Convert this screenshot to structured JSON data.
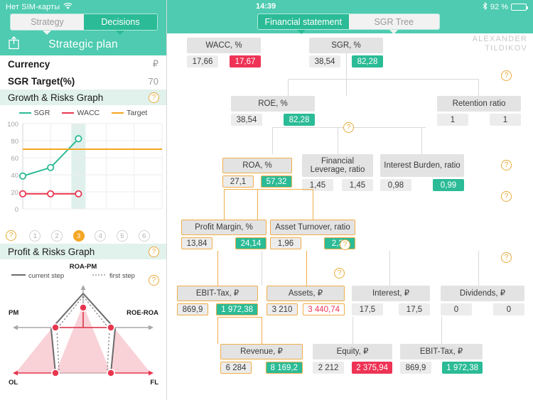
{
  "left": {
    "status": {
      "carrier": "Нет SIM-карты",
      "wifi_icon": "wifi-icon"
    },
    "segmented": {
      "inactive_label": "Strategy",
      "active_label": "Decisions"
    },
    "header": {
      "title": "Strategic plan",
      "share_icon": "share-icon"
    },
    "rows": [
      {
        "label": "Currency",
        "value": "₽"
      },
      {
        "label": "SGR Target(%)",
        "value": "70"
      }
    ],
    "growth_section": {
      "title": "Growth & Risks Graph",
      "help": "?"
    },
    "steps": {
      "items": [
        "1",
        "2",
        "3",
        "4",
        "5",
        "6"
      ],
      "selected": "3",
      "help": "?"
    },
    "profit_section": {
      "title": "Profit & Risks Graph",
      "help": "?"
    },
    "profit_graph": {
      "legend_current": "current step",
      "legend_first": "first step",
      "axis_top": "ROA-PM",
      "axis_left": "PM",
      "axis_right": "ROE-ROA",
      "axis_bottom_left": "OL",
      "axis_bottom_right": "FL",
      "help": "?"
    }
  },
  "right": {
    "status": {
      "time": "14:39",
      "battery_percent": "92 %",
      "bluetooth_icon": "bluetooth-icon",
      "battery_icon": "battery-icon"
    },
    "segmented": {
      "active_label": "Financial statement",
      "inactive_label": "SGR Tree"
    },
    "watermark_line1": "ALEXANDER",
    "watermark_line2": "TILDIKOV",
    "help_label": "?"
  },
  "chart_data": {
    "type": "line",
    "title": "Growth & Risks Graph",
    "x": [
      1,
      2,
      3,
      4,
      5,
      6
    ],
    "xlabel": "",
    "ylabel": "",
    "ylim": [
      0,
      100
    ],
    "yticks": [
      0,
      20,
      40,
      60,
      80,
      100
    ],
    "grid": true,
    "legend_position": "top",
    "highlight_step": 3,
    "series": [
      {
        "name": "SGR",
        "color": "#2bbb96",
        "values": [
          38.54,
          48.5,
          82.28,
          null,
          null,
          null
        ]
      },
      {
        "name": "WACC",
        "color": "#e8364f",
        "values": [
          17.66,
          17.66,
          17.67,
          null,
          null,
          null
        ]
      },
      {
        "name": "Target",
        "color": "#f5a623",
        "values": [
          70,
          70,
          70,
          70,
          70,
          70
        ]
      }
    ]
  },
  "tree": {
    "nodes": [
      {
        "id": "wacc",
        "title": "WACC, %",
        "v1": "17,66",
        "v2": "17,67",
        "v2_style": "red",
        "highlight": false
      },
      {
        "id": "sgr",
        "title": "SGR, %",
        "v1": "38,54",
        "v2": "82,28",
        "v2_style": "green",
        "highlight": false
      },
      {
        "id": "roe",
        "title": "ROE, %",
        "v1": "38,54",
        "v2": "82,28",
        "v2_style": "green",
        "highlight": false
      },
      {
        "id": "retention",
        "title": "Retention ratio",
        "v1": "1",
        "v2": "1",
        "v2_style": "plain",
        "highlight": false
      },
      {
        "id": "roa",
        "title": "ROA, %",
        "v1": "27,1",
        "v2": "57,32",
        "v2_style": "green",
        "highlight": true
      },
      {
        "id": "finlev",
        "title": "Financial Leverage, ratio",
        "v1": "1,45",
        "v2": "1,45",
        "v2_style": "plain",
        "highlight": false
      },
      {
        "id": "intburden",
        "title": "Interest Burden, ratio",
        "v1": "0,98",
        "v2": "0,99",
        "v2_style": "green",
        "highlight": false
      },
      {
        "id": "pmargin",
        "title": "Profit Margin, %",
        "v1": "13,84",
        "v2": "24,14",
        "v2_style": "green",
        "highlight": true
      },
      {
        "id": "aturn",
        "title": "Asset Turnover, ratio",
        "v1": "1,96",
        "v2": "2,37",
        "v2_style": "green",
        "highlight": true
      },
      {
        "id": "ebit1",
        "title": "EBIT-Tax, ₽",
        "v1": "869,9",
        "v2": "1 972,38",
        "v2_style": "green",
        "highlight": true
      },
      {
        "id": "assets",
        "title": "Assets, ₽",
        "v1": "3 210",
        "v2": "3 440,74",
        "v2_style": "red-out",
        "highlight": true
      },
      {
        "id": "interest",
        "title": "Interest, ₽",
        "v1": "17,5",
        "v2": "17,5",
        "v2_style": "plain",
        "highlight": false
      },
      {
        "id": "dividends",
        "title": "Dividends, ₽",
        "v1": "0",
        "v2": "0",
        "v2_style": "plain",
        "highlight": false
      },
      {
        "id": "revenue",
        "title": "Revenue, ₽",
        "v1": "6 284",
        "v2": "8 169,2",
        "v2_style": "green",
        "highlight": true
      },
      {
        "id": "equity",
        "title": "Equity, ₽",
        "v1": "2 212",
        "v2": "2 375,94",
        "v2_style": "red",
        "highlight": false
      },
      {
        "id": "ebit2",
        "title": "EBIT-Tax, ₽",
        "v1": "869,9",
        "v2": "1 972,38",
        "v2_style": "green",
        "highlight": false
      }
    ]
  },
  "colors": {
    "teal_header": "#4ecbb0",
    "teal_accent": "#2bbb96",
    "red_accent": "#ee3355",
    "orange_accent": "#f5a623",
    "node_bg": "#e3e3e3"
  }
}
